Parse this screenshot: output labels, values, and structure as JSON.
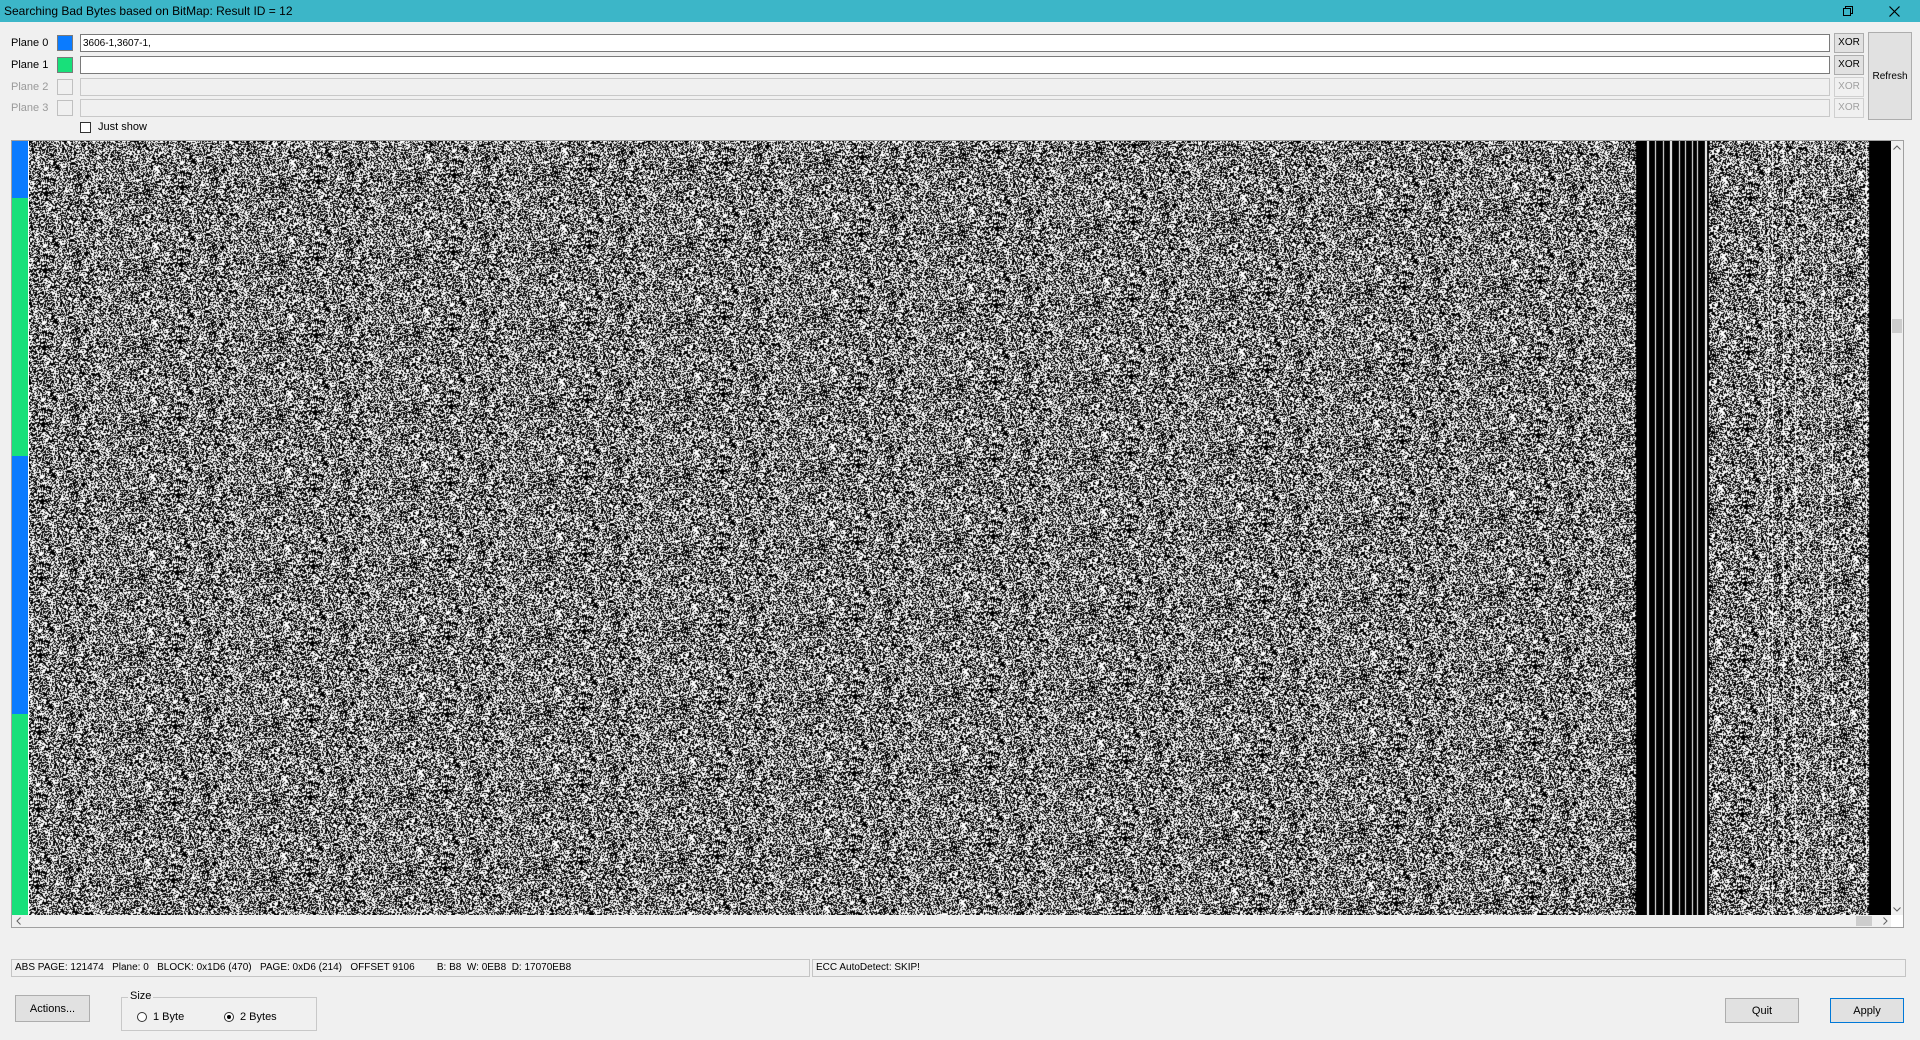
{
  "window": {
    "title": "Searching Bad Bytes based on BitMap: Result ID = 12"
  },
  "planes": [
    {
      "label": "Plane 0",
      "color": "#0a7bff",
      "value": "3606-1,3607-1,",
      "enabled": true
    },
    {
      "label": "Plane 1",
      "color": "#18e07a",
      "value": "",
      "enabled": true
    },
    {
      "label": "Plane 2",
      "color": "",
      "value": "",
      "enabled": false
    },
    {
      "label": "Plane 3",
      "color": "",
      "value": "",
      "enabled": false
    }
  ],
  "xor_label": "XOR",
  "refresh_label": "Refresh",
  "just_show": {
    "label": "Just show",
    "checked": false
  },
  "legend_colors": [
    "#0a7bff",
    "#18e07a",
    "#0a7bff",
    "#18e07a"
  ],
  "status": {
    "left": "ABS PAGE: 121474   Plane: 0   BLOCK: 0x1D6 (470)   PAGE: 0xD6 (214)   OFFSET 9106        B: B8  W: 0EB8  D: 17070EB8",
    "right": "ECC AutoDetect: SKIP!"
  },
  "buttons": {
    "actions": "Actions...",
    "quit": "Quit",
    "apply": "Apply"
  },
  "size_group": {
    "legend": "Size",
    "options": [
      {
        "label": "1 Byte",
        "selected": false
      },
      {
        "label": "2 Bytes",
        "selected": true
      }
    ]
  }
}
